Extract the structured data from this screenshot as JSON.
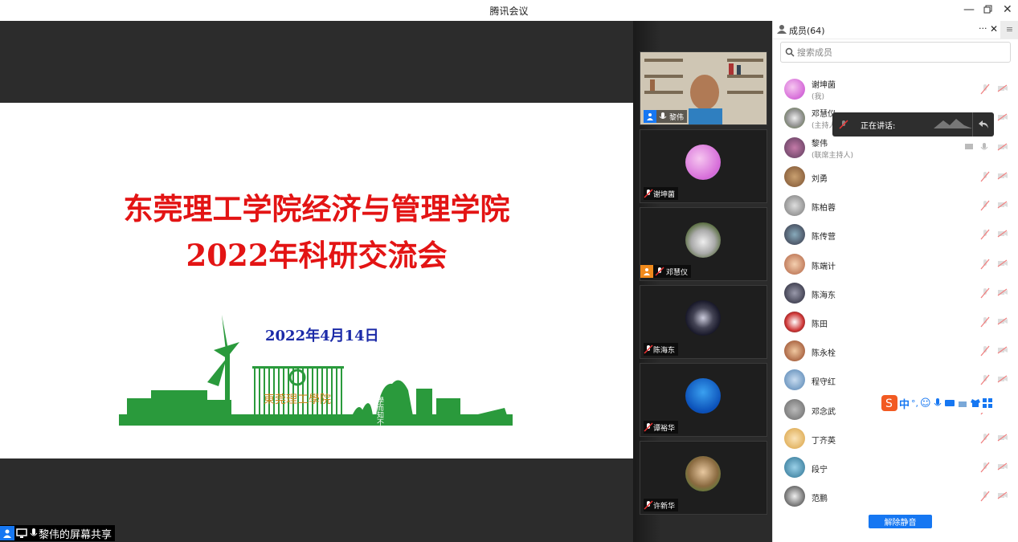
{
  "window": {
    "title": "腾讯会议",
    "minimize": "—",
    "restore": "ᗜ",
    "close": "✕"
  },
  "slide": {
    "title_line1": "东莞理工学院经济与管理学院",
    "title_line2": "2022年科研交流会",
    "date": "2022年4月14日",
    "logo_text": "東莞理工學院",
    "motto": "學而知不足"
  },
  "share_bar": {
    "label": "黎伟的屏幕共享"
  },
  "thumbnails": [
    {
      "name": "黎伟"
    },
    {
      "name": "谢坤菌"
    },
    {
      "name": "邓慧仪"
    },
    {
      "name": "陈海东"
    },
    {
      "name": "谭裕华"
    },
    {
      "name": "许新华"
    }
  ],
  "panel": {
    "title": "成员(64)",
    "more": "···",
    "close": "✕",
    "menu": "≡",
    "search_placeholder": "搜索成员",
    "unmute_button": "解除静音",
    "speaking_label": "正在讲话:",
    "members": [
      {
        "name": "谢坤菌",
        "sub": "(我)"
      },
      {
        "name": "邓慧仪",
        "sub": "(主持人)"
      },
      {
        "name": "黎伟",
        "sub": "(联席主持人)"
      },
      {
        "name": "刘勇",
        "sub": ""
      },
      {
        "name": "陈柏蓉",
        "sub": ""
      },
      {
        "name": "陈传营",
        "sub": ""
      },
      {
        "name": "陈端计",
        "sub": ""
      },
      {
        "name": "陈海东",
        "sub": ""
      },
      {
        "name": "陈田",
        "sub": ""
      },
      {
        "name": "陈永栓",
        "sub": ""
      },
      {
        "name": "程守红",
        "sub": ""
      },
      {
        "name": "邓念武",
        "sub": ""
      },
      {
        "name": "丁齐英",
        "sub": ""
      },
      {
        "name": "段宁",
        "sub": ""
      },
      {
        "name": "范鹏",
        "sub": ""
      }
    ]
  },
  "ime": {
    "lang": "中",
    "punct": "°,"
  },
  "colors": {
    "slide_title": "#e31414",
    "date": "#1b2aa8",
    "campus_green": "#2a9a3c",
    "accent_blue": "#1677f2"
  }
}
